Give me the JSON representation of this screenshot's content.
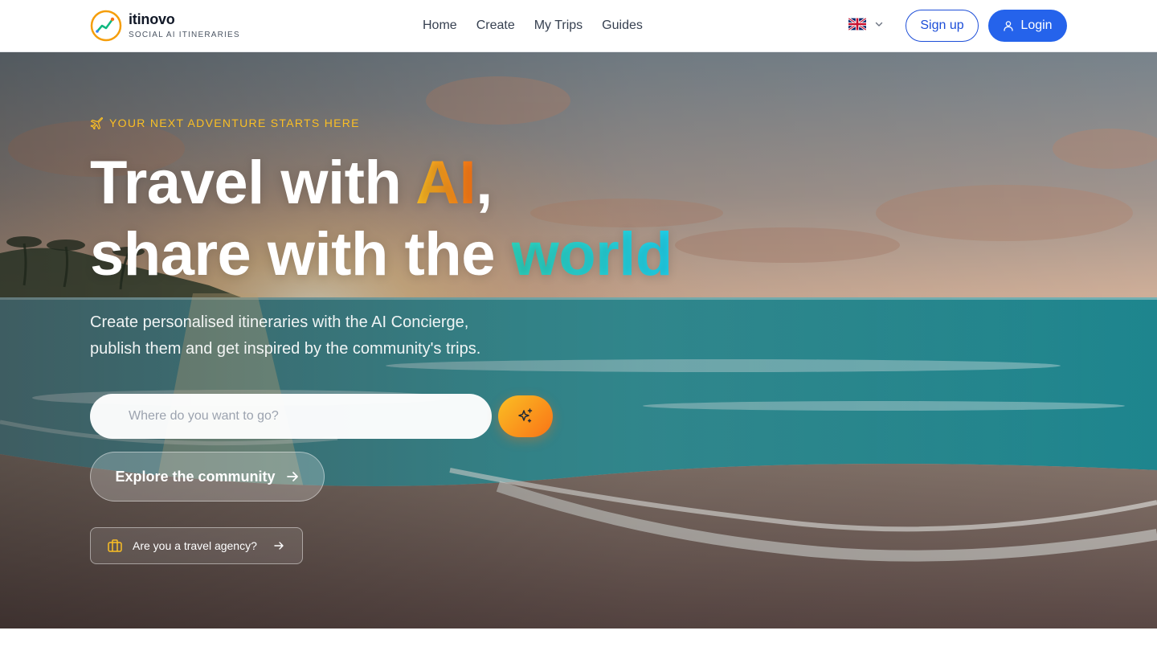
{
  "brand": {
    "name": "itinovo",
    "tagline": "SOCIAL AI ITINERARIES"
  },
  "nav": {
    "items": [
      {
        "label": "Home"
      },
      {
        "label": "Create"
      },
      {
        "label": "My Trips"
      },
      {
        "label": "Guides"
      }
    ]
  },
  "language": {
    "selected": "en-GB",
    "icon": "uk-flag-icon"
  },
  "auth": {
    "signup_label": "Sign up",
    "login_label": "Login"
  },
  "hero": {
    "eyebrow": "YOUR NEXT ADVENTURE STARTS HERE",
    "headline": {
      "part1": "Travel with ",
      "accent1": "AI",
      "part2": ",",
      "part3": "share with the ",
      "accent2": "world"
    },
    "subtitle_line1": "Create personalised itineraries with the AI Concierge,",
    "subtitle_line2": "publish them and get inspired by the community's trips.",
    "search_placeholder": "Where do you want to go?",
    "search_value": "",
    "explore_label": "Explore the community",
    "agency_label": "Are you a travel agency?"
  },
  "colors": {
    "primary": "#2563eb",
    "accent_orange": "#f59e0b",
    "accent_cyan": "#22d3ee",
    "eyebrow": "#fbbf24"
  }
}
